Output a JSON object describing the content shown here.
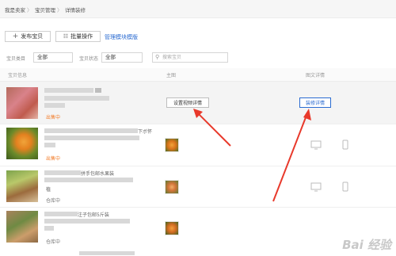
{
  "breadcrumb": {
    "items": [
      "我是卖家",
      "宝贝管理",
      "详情装修"
    ],
    "separator": "〉"
  },
  "toolbar": {
    "publish_label": "发布宝贝",
    "batch_label": "批量操作",
    "template_link": "管理模块模版"
  },
  "filters": {
    "category_label": "宝贝类目",
    "category_value": "全部",
    "status_label": "宝贝状态",
    "status_value": "全部",
    "search_placeholder": "搜索宝贝"
  },
  "table": {
    "headers": [
      "宝贝信息",
      "主图",
      "图文详情"
    ],
    "rows": [
      {
        "text_visible": "",
        "status": "出售中",
        "main_image_button": "设置视频详情",
        "detail_button": "装修详情"
      },
      {
        "text_visible": "下ボ怀",
        "status": "出售中",
        "main_image_button": "",
        "detail_button": ""
      },
      {
        "text_visible": "拼手包邮水果装",
        "sub_text": "植",
        "status": "仓库中",
        "main_image_button": "",
        "detail_button": ""
      },
      {
        "text_visible": "注子包邮5斤装",
        "status": "仓库中",
        "main_image_button": "",
        "detail_button": ""
      }
    ]
  },
  "colors": {
    "accent": "#2a6bd1",
    "status_selling": "#f27d2a",
    "arrow": "#e8392b"
  },
  "watermark": "Bai 经验"
}
